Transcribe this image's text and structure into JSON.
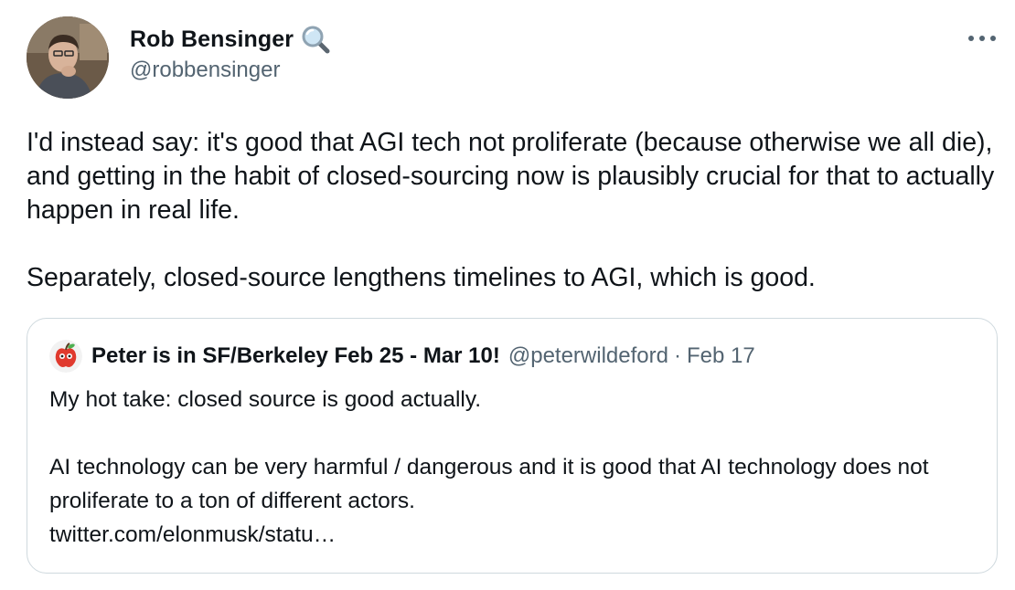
{
  "author": {
    "display_name": "Rob Bensinger",
    "badge_icon": "magnifying-glass-icon",
    "handle": "@robbensinger"
  },
  "tweet": {
    "paragraphs": [
      "I'd instead say: it's good that AGI tech not proliferate (because otherwise we all die), and getting in the habit of closed-sourcing now is plausibly crucial for that to actually happen in real life.",
      "Separately, closed-source lengthens timelines to AGI, which is good."
    ]
  },
  "quoted_tweet": {
    "avatar_icon": "apple-avatar-icon",
    "display_name": "Peter is in SF/Berkeley Feb 25 - Mar 10!",
    "handle": "@peterwildeford",
    "separator": "·",
    "date": "Feb 17",
    "paragraphs": [
      "My hot take: closed source is good actually.",
      "AI technology can be very harmful / dangerous and it is good that AI technology does not proliferate to a ton of different actors."
    ],
    "link": "twitter.com/elonmusk/statu…"
  },
  "colors": {
    "text_primary": "#0f1419",
    "text_secondary": "#536471",
    "border": "#cfd9de"
  }
}
